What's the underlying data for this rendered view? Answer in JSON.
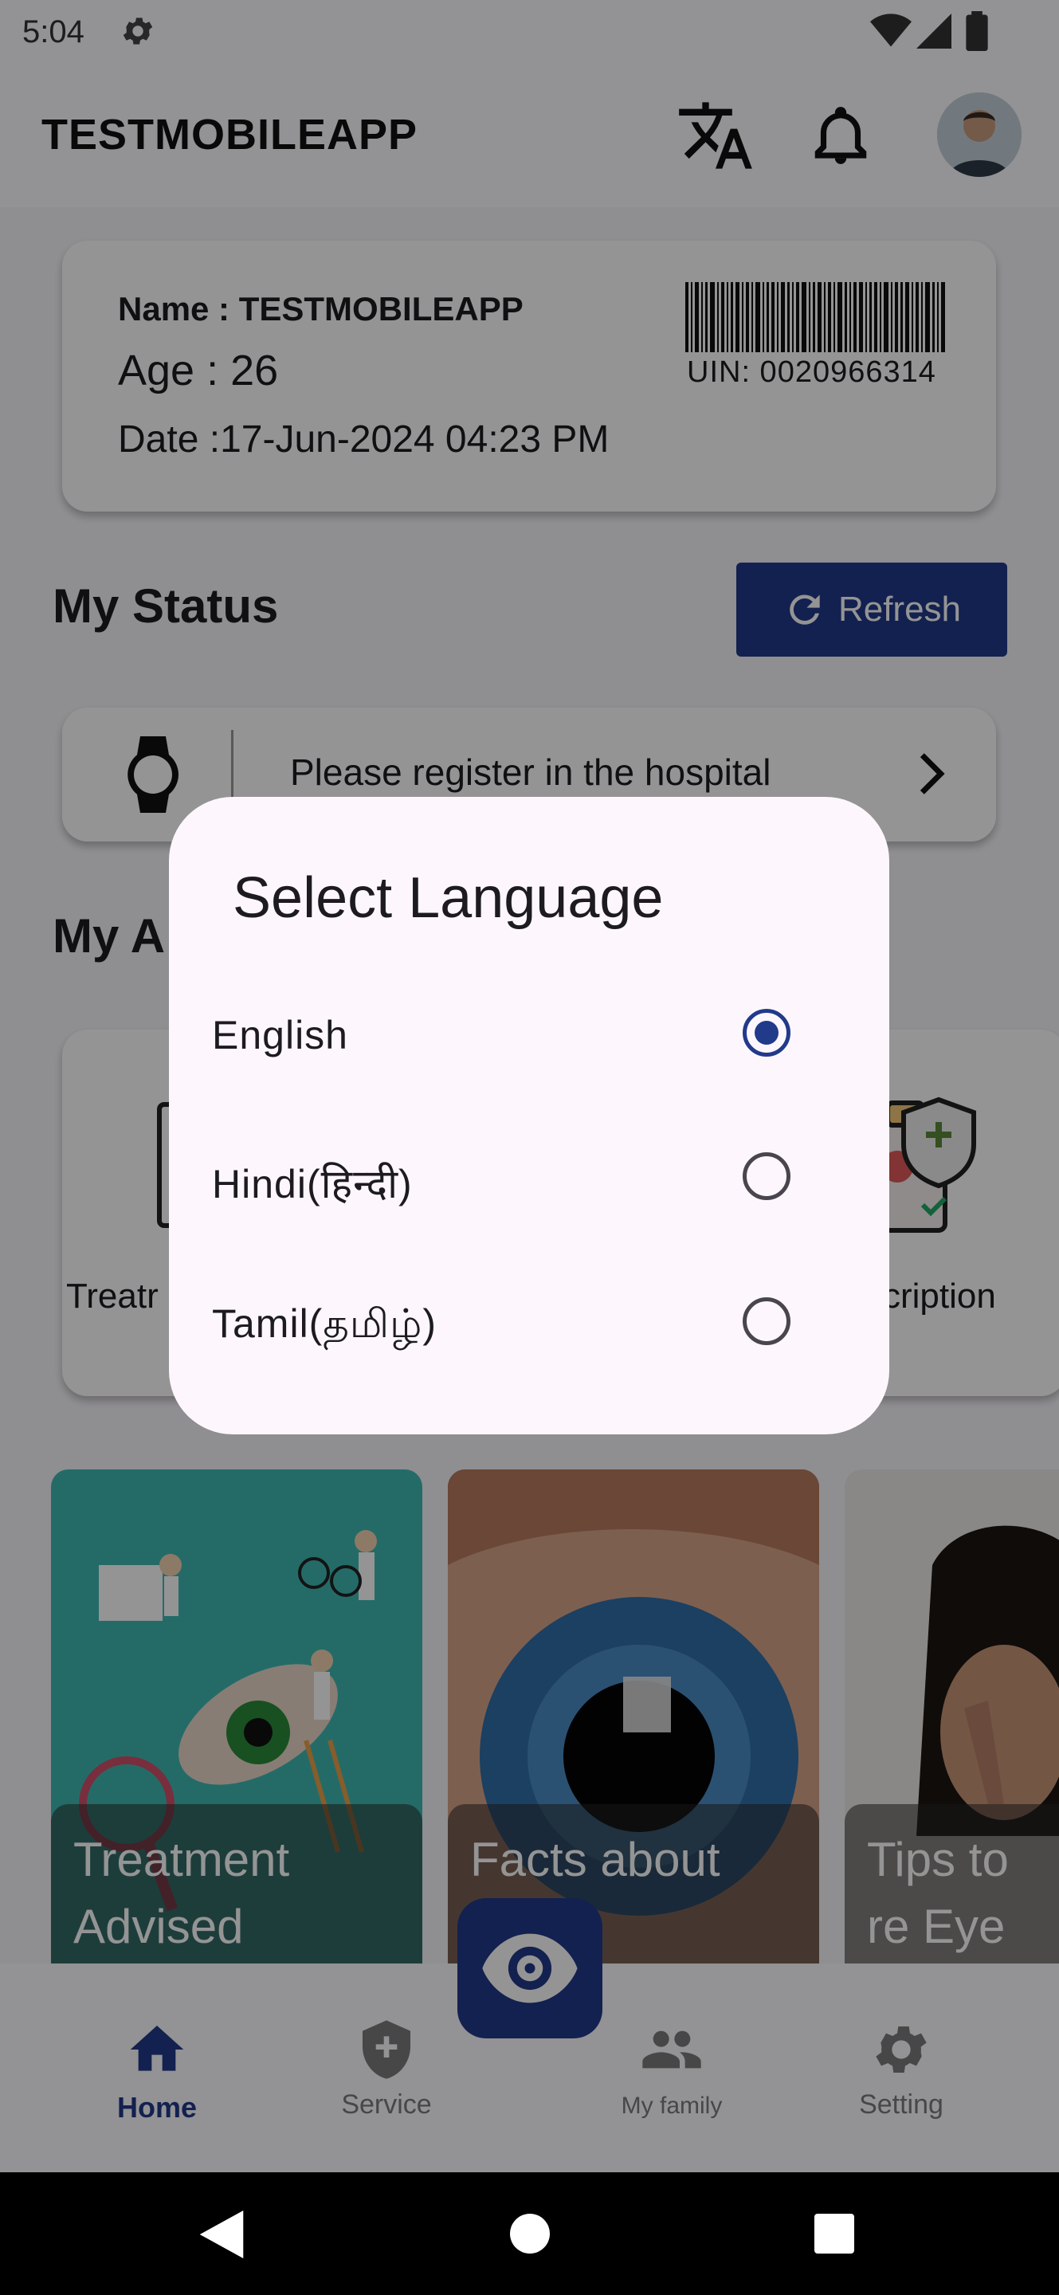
{
  "status_bar": {
    "time": "5:04"
  },
  "app_bar": {
    "title": "TESTMOBILEAPP"
  },
  "profile": {
    "name": "Name : TESTMOBILEAPP",
    "age": "Age : 26",
    "date": "Date :17-Jun-2024 04:23 PM",
    "uin": "UIN: 0020966314"
  },
  "status": {
    "heading": "My Status",
    "refresh_label": "Refresh",
    "message": "Please register in the hospital"
  },
  "appointments": {
    "heading": "My A",
    "treatment_label": "Treatr",
    "prescription_label": "cription"
  },
  "tiles": [
    {
      "caption": "Treatment Advised"
    },
    {
      "caption": "Facts about"
    },
    {
      "caption": "Tips to re Eye Strai"
    }
  ],
  "bottom_nav": {
    "home": "Home",
    "service": "Service",
    "family": "My family",
    "setting": "Setting"
  },
  "dialog": {
    "title": "Select Language",
    "options": [
      {
        "label": "English",
        "selected": true
      },
      {
        "label": "Hindi(हिन्दी)",
        "selected": false
      },
      {
        "label": "Tamil(தமிழ்)",
        "selected": false
      }
    ]
  },
  "colors": {
    "primary": "#213a8a",
    "dialog_bg": "#fdf7fd",
    "scrim": "rgba(0,0,0,0.42)"
  }
}
